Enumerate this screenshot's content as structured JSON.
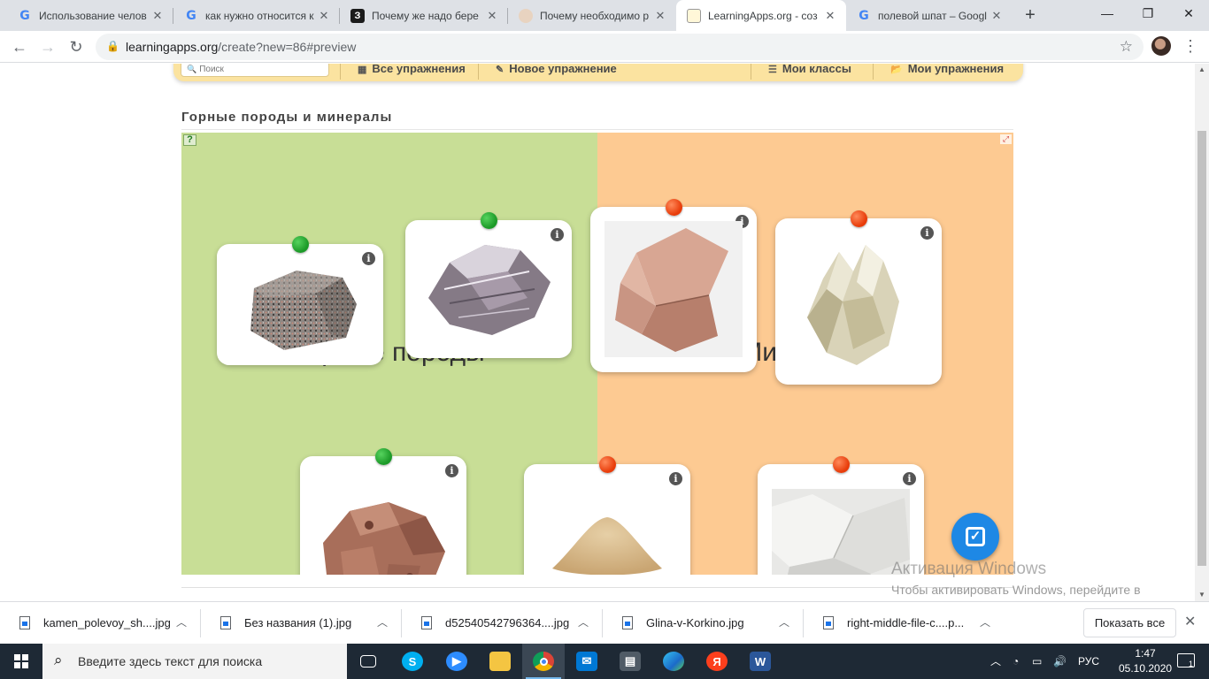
{
  "browser": {
    "tabs": [
      {
        "title": "Использование челов",
        "icon": "google-icon"
      },
      {
        "title": "как нужно относится к",
        "icon": "google-icon"
      },
      {
        "title": "Почему же надо бере",
        "icon": "znanija-icon"
      },
      {
        "title": "Почему необходимо р",
        "icon": "site-icon"
      },
      {
        "title": "LearningApps.org - соз",
        "icon": "learningapps-icon"
      },
      {
        "title": "полевой шпат – Googl",
        "icon": "google-icon"
      }
    ],
    "url_host": "learningapps.org",
    "url_path": "/create?new=86#preview"
  },
  "site_nav": {
    "search_placeholder": "Поиск",
    "items": [
      "Все упражнения",
      "Новое упражнение",
      "Мои классы",
      "Мои упражнения"
    ]
  },
  "app": {
    "title": "Горные породы и минералы",
    "zones": [
      {
        "label": "Горные породы",
        "color": "#c8de96"
      },
      {
        "label": "Минералы",
        "color": "#fdca92"
      }
    ],
    "cards": [
      {
        "image": "granite-rock",
        "status": "correct"
      },
      {
        "image": "mica-mineral",
        "status": "correct"
      },
      {
        "image": "feldspar-mineral",
        "status": "incorrect"
      },
      {
        "image": "quartz-crystal",
        "status": "incorrect"
      },
      {
        "image": "clay-rock",
        "status": "correct"
      },
      {
        "image": "sand-pile",
        "status": "incorrect"
      },
      {
        "image": "chalk-rock",
        "status": "incorrect"
      }
    ],
    "status_colors": {
      "correct": "#1c9a28",
      "incorrect": "#e83c0a"
    }
  },
  "windows_watermark": {
    "title": "Активация Windows",
    "subtitle": "Чтобы активировать Windows, перейдите в раздел \"Параметры\"."
  },
  "downloads": {
    "files": [
      "kamen_polevoy_sh....jpg",
      "Без названия (1).jpg",
      "d52540542796364....jpg",
      "Glina-v-Korkino.jpg",
      "right-middle-file-c....p..."
    ],
    "show_all": "Показать все"
  },
  "taskbar": {
    "search_placeholder": "Введите здесь текст для поиска",
    "language": "РУС",
    "time": "1:47",
    "date": "05.10.2020",
    "notification_count": "1"
  }
}
